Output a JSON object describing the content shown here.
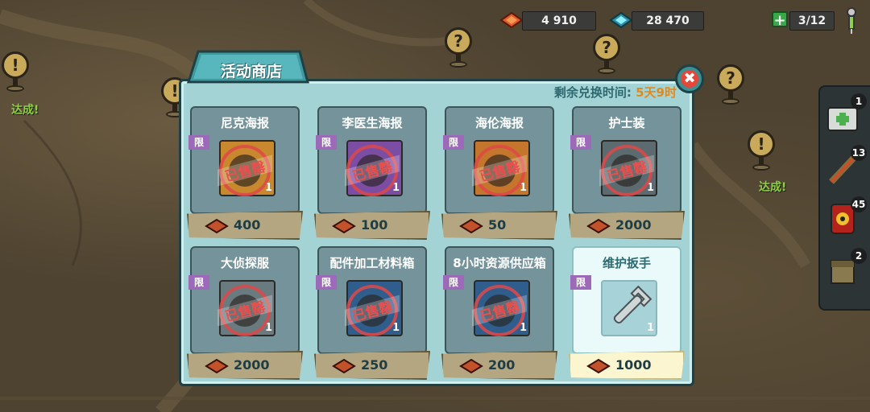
{
  "currencies": [
    {
      "name": "caps",
      "value": "4 910",
      "color": "#e05a2a"
    },
    {
      "name": "quantum",
      "value": "28 470",
      "color": "#38c6d8"
    }
  ],
  "lunchbox": {
    "value": "3/12"
  },
  "map": {
    "done_labels": [
      "达成!",
      "达成!"
    ]
  },
  "side_panel": [
    {
      "icon": "first-aid-kit-icon",
      "count": "1"
    },
    {
      "icon": "stimpak-icon",
      "count": "13"
    },
    {
      "icon": "radaway-icon",
      "count": "45"
    },
    {
      "icon": "supply-box-icon",
      "count": "2"
    }
  ],
  "dialog": {
    "title": "活动商店",
    "timer_label": "剩余兑换时间:",
    "timer_value": "5天9时",
    "close_glyph": "✖",
    "limit_label": "限",
    "sold_label": "已售罄"
  },
  "items": [
    {
      "name": "尼克海报",
      "price": "400",
      "qty": "1",
      "sold": true,
      "tint": "#c7882e"
    },
    {
      "name": "李医生海报",
      "price": "100",
      "qty": "1",
      "sold": true,
      "tint": "#7b4ea4"
    },
    {
      "name": "海伦海报",
      "price": "50",
      "qty": "1",
      "sold": true,
      "tint": "#c4762c"
    },
    {
      "name": "护士装",
      "price": "2000",
      "qty": "1",
      "sold": true,
      "tint": "#5b6b70"
    },
    {
      "name": "大侦探服",
      "price": "2000",
      "qty": "1",
      "sold": true,
      "tint": "#6a7b80"
    },
    {
      "name": "配件加工材料箱",
      "price": "250",
      "qty": "1",
      "sold": true,
      "tint": "#2f5e8c"
    },
    {
      "name": "8小时资源供应箱",
      "price": "200",
      "qty": "1",
      "sold": true,
      "tint": "#2f5e8c"
    },
    {
      "name": "维护扳手",
      "price": "1000",
      "qty": "1",
      "sold": false,
      "tint": "#a6d2d8"
    }
  ]
}
